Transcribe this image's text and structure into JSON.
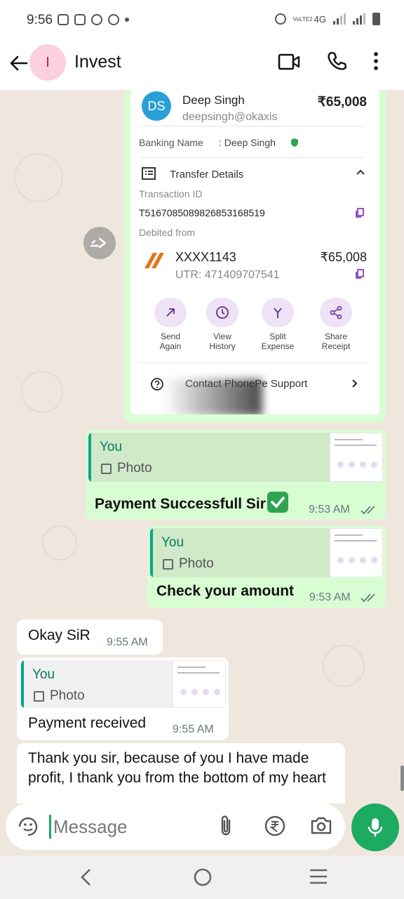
{
  "status_bar": {
    "time": "9:56",
    "network": "4G",
    "volte": "VoLTE2"
  },
  "header": {
    "avatar_letter": "I",
    "title": "Invest",
    "icons": [
      "back-arrow-icon",
      "video-call-icon",
      "phone-icon",
      "more-vert-icon"
    ]
  },
  "receipt": {
    "payee_initials": "DS",
    "payee_name": "Deep Singh",
    "payee_upi": "deepsingh@okaxis",
    "amount": "₹65,008",
    "banking_name_label": "Banking Name",
    "banking_name_value": ": Deep Singh",
    "transfer_details_label": "Transfer Details",
    "transaction_id_label": "Transaction ID",
    "transaction_id": "T516708508982685316851​9",
    "debited_from_label": "Debited from",
    "account": "XXXX1143",
    "utr": "UTR: 471409707541",
    "debit_amount": "₹65,008",
    "actions": [
      {
        "label": "Send\nAgain",
        "icon": "arrow-up-right-icon"
      },
      {
        "label": "View\nHistory",
        "icon": "clock-icon"
      },
      {
        "label": "Split\nExpense",
        "icon": "split-icon"
      },
      {
        "label": "Share\nReceipt",
        "icon": "share-icon"
      }
    ],
    "support_label": "Contact PhonePe Support"
  },
  "messages": {
    "m1": {
      "author": "You",
      "photo_label": "Photo",
      "text": "Payment Successfull Sir",
      "time": "9:53 AM"
    },
    "m2": {
      "author": "You",
      "photo_label": "Photo",
      "text": "Check your amount",
      "time": "9:53 AM"
    },
    "m3": {
      "text": "Okay SiR",
      "time": "9:55 AM"
    },
    "m4": {
      "author": "You",
      "photo_label": "Photo",
      "text": "Payment received",
      "time": "9:55 AM"
    },
    "m5": {
      "text": "Thank you sir, because of you I have made profit, I thank you from the bottom of my heart"
    }
  },
  "composer": {
    "placeholder": "Message"
  },
  "colors": {
    "outgoing_bubble": "#d9fdd3",
    "accent_green": "#1daa61",
    "chat_background": "#efe7de"
  }
}
